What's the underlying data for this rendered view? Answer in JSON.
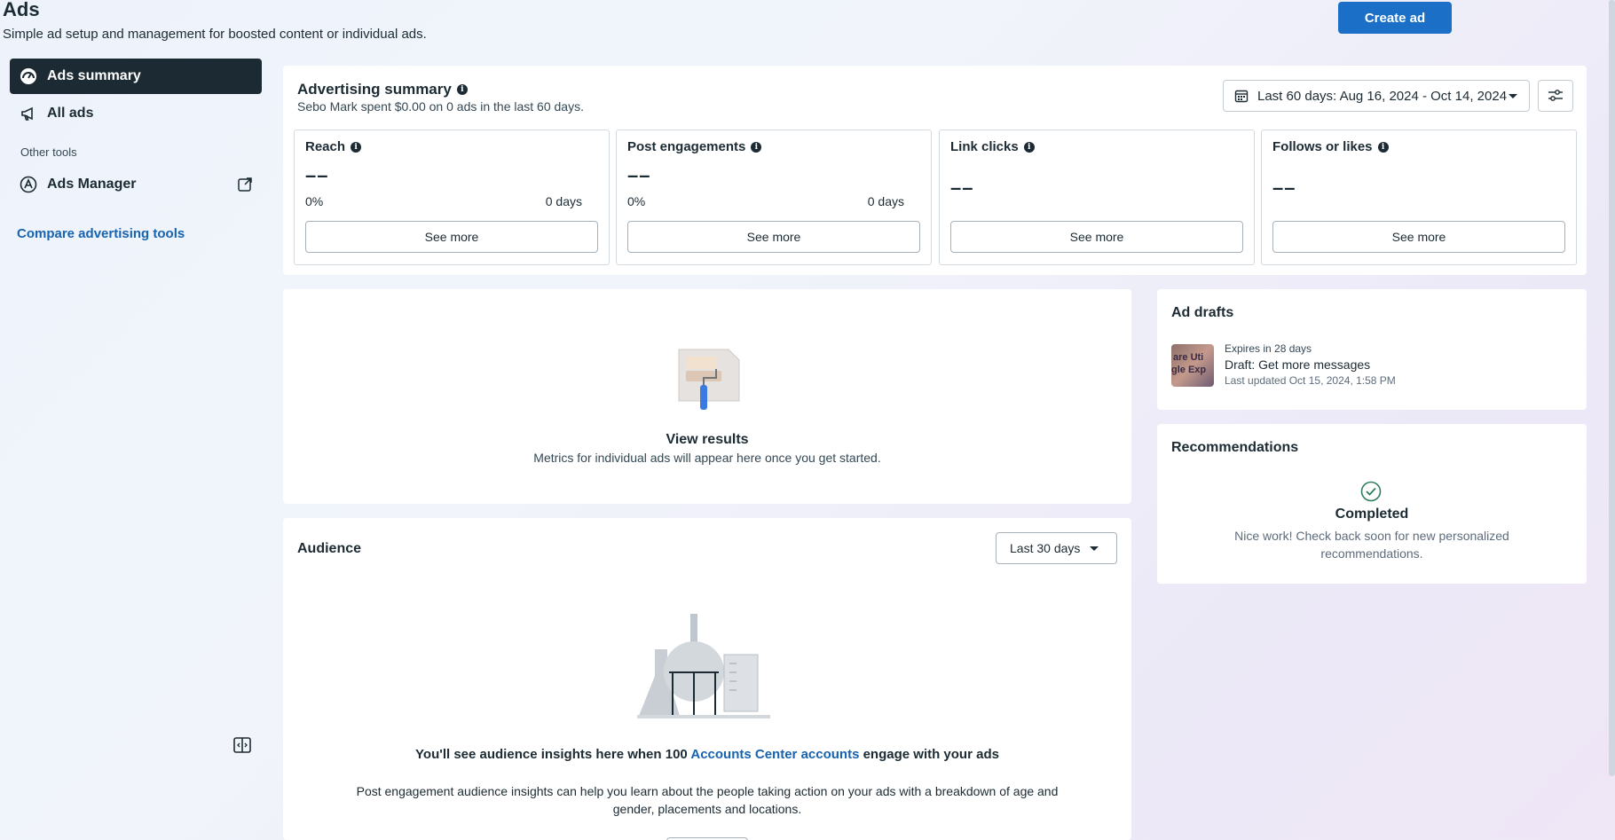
{
  "header": {
    "title": "Ads",
    "subtitle": "Simple ad setup and management for boosted content or individual ads.",
    "create_label": "Create ad"
  },
  "sidebar": {
    "items": [
      {
        "label": "Ads summary",
        "icon": "dashboard-icon",
        "active": true
      },
      {
        "label": "All ads",
        "icon": "megaphone-icon",
        "active": false
      }
    ],
    "other_tools_label": "Other tools",
    "ads_manager_label": "Ads Manager",
    "compare_label": "Compare advertising tools"
  },
  "summary": {
    "title": "Advertising summary",
    "subtitle": "Sebo Mark spent $0.00 on 0 ads in the last 60 days.",
    "date_range": "Last 60 days: Aug 16, 2024 - Oct 14, 2024",
    "metrics": [
      {
        "title": "Reach",
        "value": "––",
        "pct": "0%",
        "days": "0 days",
        "button": "See more"
      },
      {
        "title": "Post engagements",
        "value": "––",
        "pct": "0%",
        "days": "0 days",
        "button": "See more"
      },
      {
        "title": "Link clicks",
        "value": "––",
        "button": "See more"
      },
      {
        "title": "Follows or likes",
        "value": "––",
        "button": "See more"
      }
    ]
  },
  "results": {
    "title": "View results",
    "subtitle": "Metrics for individual ads will appear here once you get started."
  },
  "drafts": {
    "title": "Ad drafts",
    "thumb_text_1": "are Uti",
    "thumb_text_2": "gle Exp",
    "expires": "Expires in 28 days",
    "name": "Draft: Get more messages",
    "updated": "Last updated Oct 15, 2024, 1:58 PM"
  },
  "recommendations": {
    "title": "Recommendations",
    "status": "Completed",
    "message": "Nice work! Check back soon for new personalized recommendations."
  },
  "audience": {
    "title": "Audience",
    "range": "Last 30 days",
    "main_prefix": "You'll see audience insights here when 100 ",
    "main_link": "Accounts Center accounts",
    "main_suffix": " engage with your ads",
    "description": "Post engagement audience insights can help you learn about the people taking action on your ads with a breakdown of age and gender, placements and locations."
  },
  "colors": {
    "primary": "#1b6fc7",
    "link": "#1763b0",
    "active_nav": "#1c2b33",
    "success": "#2e7d5b"
  }
}
